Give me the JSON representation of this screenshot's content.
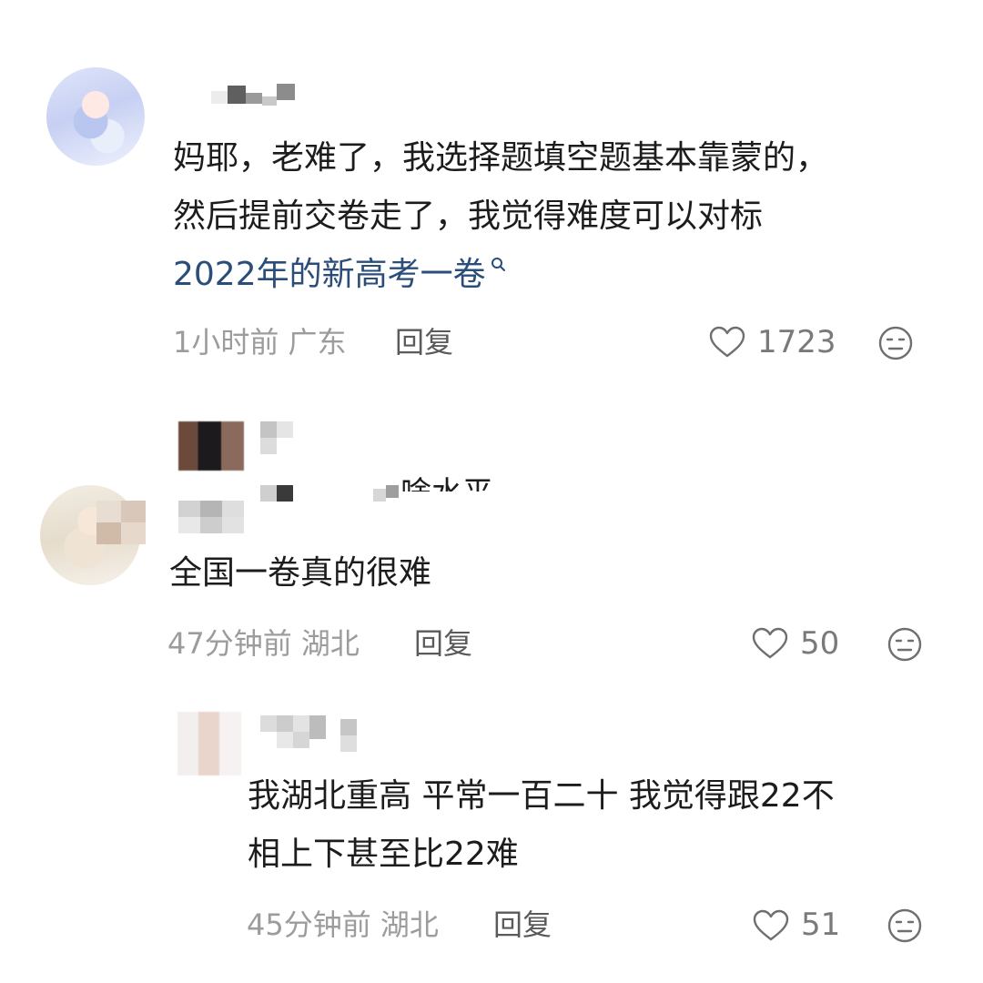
{
  "comments": [
    {
      "text_lines": [
        "妈耶，老难了，我选择题填空题基本靠蒙的，",
        "然后提前交卷走了，我觉得难度可以对标"
      ],
      "link_text": "2022年的新高考一卷",
      "time": "1小时前",
      "location": "广东",
      "reply_label": "回复",
      "likes": "1723"
    },
    {
      "partial_text": "啥水平",
      "text_lines": [
        "全国一卷真的很难"
      ],
      "time": "47分钟前",
      "location": "湖北",
      "reply_label": "回复",
      "likes": "50"
    },
    {
      "text_lines": [
        "我湖北重高 平常一百二十 我觉得跟22不",
        "相上下甚至比22难"
      ],
      "time": "45分钟前",
      "location": "湖北",
      "reply_label": "回复",
      "likes": "51"
    }
  ],
  "icons": {
    "like": "heart-outline-icon",
    "dislike": "meh-face-icon",
    "search": "search-icon"
  },
  "colors": {
    "text": "#1c1c1c",
    "link": "#2a4d7a",
    "meta": "#9c9c9c",
    "icon": "#6f6f6f"
  }
}
